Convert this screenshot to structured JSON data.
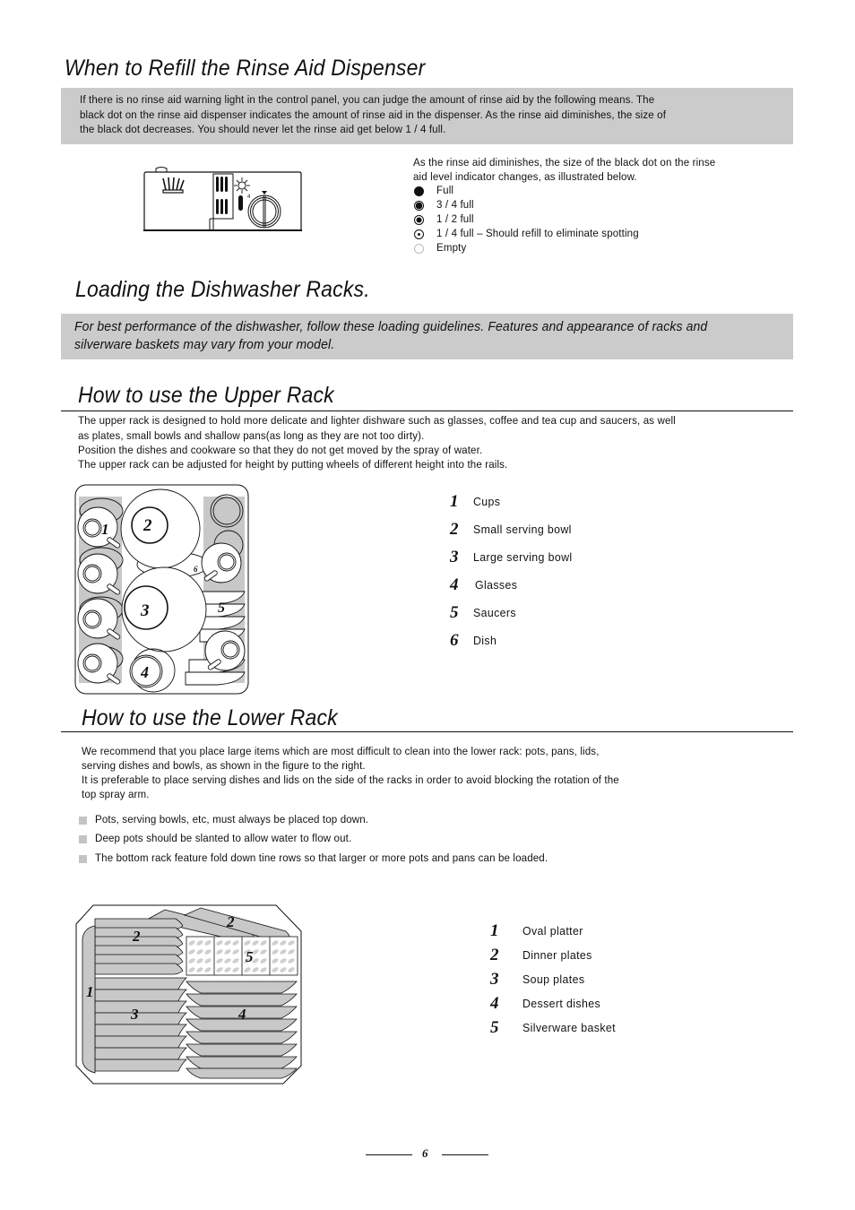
{
  "refill_section": {
    "title": "When to Refill the Rinse Aid Dispenser",
    "intro_lines": [
      "If there is no rinse aid warning light in the control panel, you can judge the amount of rinse aid by the following means. The",
      "black dot on the rinse aid dispenser indicates the amount of rinse aid in the dispenser. As the rinse aid diminishes, the size of",
      "the black dot decreases. You should never let the rinse aid get below 1 / 4 full."
    ],
    "indicator_desc_lines": [
      "As the rinse aid diminishes, the size of the black dot on the rinse",
      "aid level indicator changes, as illustrated below."
    ],
    "levels": [
      {
        "label": "Full",
        "fill": 1.0
      },
      {
        "label": "3 / 4 full",
        "fill": 0.75
      },
      {
        "label": "1 / 2 full",
        "fill": 0.5
      },
      {
        "label": "1 / 4 full – Should refill to eliminate spotting",
        "fill": 0.25
      },
      {
        "label": "Empty",
        "fill": 0.0
      }
    ]
  },
  "loading_section": {
    "title": "Loading the Dishwasher Racks.",
    "note_lines": [
      "For best performance of the dishwasher, follow these loading guidelines. Features and appearance of racks and",
      "silverware baskets may vary from your model."
    ]
  },
  "upper_rack": {
    "title": "How to use the Upper Rack",
    "lines": [
      "The upper rack is designed to hold more delicate and lighter dishware such as glasses, coffee and tea cup and saucers, as well",
      "as plates, small bowls and shallow pans(as long as they are not too dirty).",
      "Position the dishes and cookware so that they do not get moved by the spray of water.",
      "The upper rack can be adjusted for height by putting wheels of different height into the rails."
    ],
    "legend": [
      {
        "num": "1",
        "label": "Cups"
      },
      {
        "num": "2",
        "label": "Small serving bowl"
      },
      {
        "num": "3",
        "label": "Large serving bowl"
      },
      {
        "num": "4",
        "label": "Glasses"
      },
      {
        "num": "5",
        "label": "Saucers"
      },
      {
        "num": "6",
        "label": "Dish"
      }
    ],
    "figure_labels": [
      "1",
      "2",
      "3",
      "4",
      "5",
      "6"
    ]
  },
  "lower_rack": {
    "title": "How to use the Lower Rack",
    "lines": [
      "We recommend that you place large items which are  most  difficult to clean into the lower rack: pots, pans, lids,",
      "serving  dishes and bowls, as shown in the figure to the right.",
      "It is preferable to place serving dishes and lids on the side of  the racks in order to avoid blocking the rotation of the",
      "top spray arm."
    ],
    "bullets": [
      "Pots, serving bowls, etc, must always be placed top down.",
      "Deep pots should be slanted to allow water to flow out.",
      "The bottom rack feature fold down tine rows so that larger or more pots and pans can be loaded."
    ],
    "legend": [
      {
        "num": "1",
        "label": "Oval platter"
      },
      {
        "num": "2",
        "label": "Dinner plates"
      },
      {
        "num": "3",
        "label": "Soup plates"
      },
      {
        "num": "4",
        "label": "Dessert dishes"
      },
      {
        "num": "5",
        "label": "Silverware  basket"
      }
    ],
    "figure_labels": [
      "1",
      "2",
      "2",
      "3",
      "4",
      "5"
    ]
  },
  "footer": {
    "page_number": "6"
  },
  "colors": {
    "box_grey": "#cbcbcb",
    "rack_grey": "#c8c8c8",
    "ink": "#111111"
  }
}
